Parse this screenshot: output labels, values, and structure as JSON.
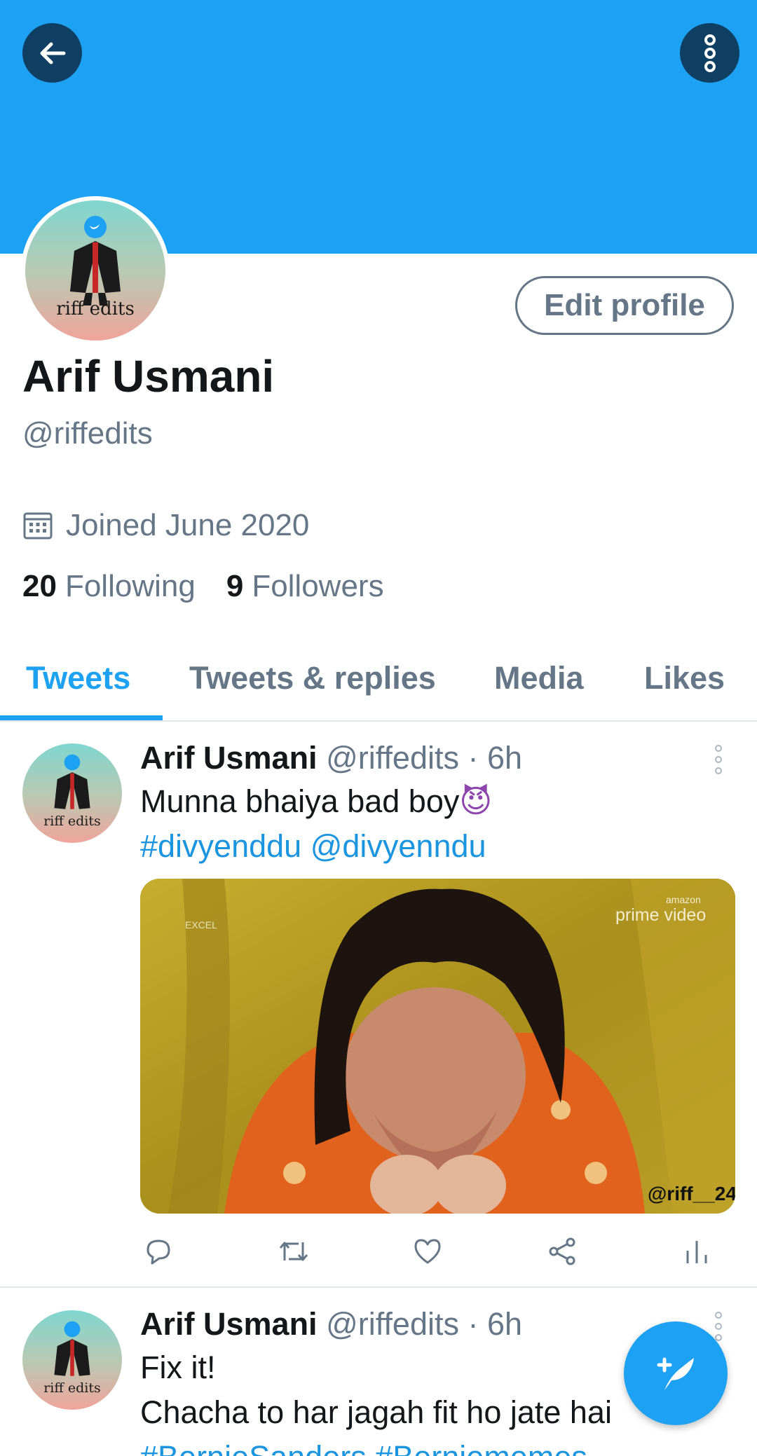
{
  "header": {
    "back_icon": "arrow-left-icon",
    "more_icon": "more-vertical-icon",
    "banner_color": "#1da1f2"
  },
  "profile": {
    "avatar_text": "riff edits",
    "edit_button": "Edit profile",
    "display_name": "Arif Usmani",
    "handle": "@riffedits",
    "joined": "Joined June 2020",
    "following_count": "20",
    "following_label": "Following",
    "followers_count": "9",
    "followers_label": "Followers"
  },
  "tabs": [
    {
      "label": "Tweets",
      "active": true
    },
    {
      "label": "Tweets & replies",
      "active": false
    },
    {
      "label": "Media",
      "active": false
    },
    {
      "label": "Likes",
      "active": false
    }
  ],
  "tweets": [
    {
      "name": "Arif Usmani",
      "handle": "@riffedits",
      "separator": "·",
      "time": "6h",
      "avatar_text": "riff edits",
      "text_line1": "Munna bhaiya bad boy",
      "emoji": "😈",
      "hashtag": "#divyenddu",
      "mention": "@divyenndu",
      "media": {
        "watermark_top_left": "EXCEL",
        "watermark_top_right_small": "amazon",
        "watermark_top_right": "prime video",
        "watermark_bottom_right": "@riff__24"
      }
    },
    {
      "name": "Arif Usmani",
      "handle": "@riffedits",
      "separator": "·",
      "time": "6h",
      "avatar_text": "riff edits",
      "text_line1": "Fix it!",
      "text_line2": "Chacha to har jagah fit ho jate hai",
      "hashtags_line": "#BernieSanders #Berniememes"
    }
  ],
  "actions": [
    "reply-icon",
    "retweet-icon",
    "like-icon",
    "share-icon",
    "analytics-icon"
  ],
  "fab": {
    "icon": "compose-tweet-icon"
  }
}
